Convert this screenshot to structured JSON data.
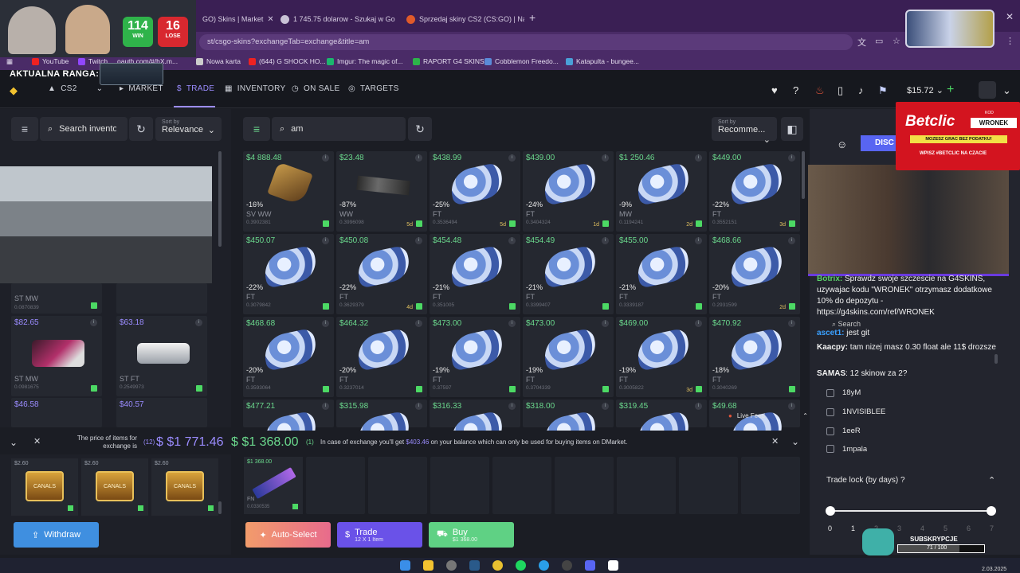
{
  "browser": {
    "tabs": [
      {
        "title": "GO) Skins | Market"
      },
      {
        "title": "1 745.75 dolarow - Szukaj w Go"
      },
      {
        "title": "Sprzedaj skiny CS2 (CS:GO) | Na"
      }
    ],
    "url": "st/csgo-skins?exchangeTab=exchange&title=am",
    "bookmarks": [
      "YouTube",
      "Twitch",
      "oauth.com/#/hX.m...",
      "Nowa karta",
      "(644) G SHOCK HO...",
      "Imgur: The magic of...",
      "RAPORT G4 SKINS",
      "Cobblemon Freedo...",
      "Katapulta - bungee..."
    ]
  },
  "overlay": {
    "win": {
      "count": "114",
      "label": "WIN"
    },
    "lose": {
      "count": "16",
      "label": "LOSE"
    },
    "rank_label": "AKTUALNA RANGA:",
    "betclic": {
      "logo": "Betclic",
      "kod": "KOD",
      "code": "WRONEK",
      "strip": "MOZESZ GRAC BEZ PODATKU!",
      "foot": "WPISZ #BETCLIC NA CZACIE"
    },
    "sub_goal": {
      "label": "SUBSKRYPCJE",
      "progress": "71 / 100"
    }
  },
  "site": {
    "game": "CS2",
    "nav": {
      "market": "MARKET",
      "trade": "TRADE",
      "inventory": "INVENTORY",
      "on_sale": "ON SALE",
      "targets": "TARGETS"
    },
    "balance": "$15.72"
  },
  "left_panel": {
    "search_placeholder": "Search inventory",
    "sort_label": "Sort by",
    "sort_value": "Relevance",
    "items": [
      {
        "ext": "ST MW",
        "float": "0.0870839"
      },
      {
        "price": "$82.65",
        "ext": "ST MW",
        "float": "0.0981675"
      },
      {
        "price": "$63.18",
        "ext": "ST FT",
        "float": "0.2549973"
      },
      {
        "price": "$46.58"
      },
      {
        "price": "$40.57"
      }
    ]
  },
  "market": {
    "search_value": "am",
    "sort_label": "Sort by",
    "sort_value": "Recomme...",
    "cards": [
      {
        "price": "$4 888.48",
        "disc": "-16%",
        "ext": "SV WW",
        "float": "0.3902381",
        "days": ""
      },
      {
        "price": "$23.48",
        "disc": "-87%",
        "ext": "WW",
        "float": "0.3996098",
        "days": "5d"
      },
      {
        "price": "$438.99",
        "disc": "-25%",
        "ext": "FT",
        "float": "0.3536494",
        "days": "5d"
      },
      {
        "price": "$439.00",
        "disc": "-24%",
        "ext": "FT",
        "float": "0.3404324",
        "days": "1d"
      },
      {
        "price": "$1 250.46",
        "disc": "-9%",
        "ext": "MW",
        "float": "0.1194241",
        "days": "2d"
      },
      {
        "price": "$449.00",
        "disc": "-22%",
        "ext": "FT",
        "float": "0.3552151",
        "days": "3d"
      },
      {
        "price": "$450.07",
        "disc": "-22%",
        "ext": "FT",
        "float": "0.3079842",
        "days": ""
      },
      {
        "price": "$450.08",
        "disc": "-22%",
        "ext": "FT",
        "float": "0.3629379",
        "days": "4d"
      },
      {
        "price": "$454.48",
        "disc": "-21%",
        "ext": "FT",
        "float": "0.351005",
        "days": ""
      },
      {
        "price": "$454.49",
        "disc": "-21%",
        "ext": "FT",
        "float": "0.3399407",
        "days": ""
      },
      {
        "price": "$455.00",
        "disc": "-21%",
        "ext": "FT",
        "float": "0.3339187",
        "days": ""
      },
      {
        "price": "$468.66",
        "disc": "-20%",
        "ext": "FT",
        "float": "0.2931599",
        "days": "2d"
      },
      {
        "price": "$468.68",
        "disc": "-20%",
        "ext": "FT",
        "float": "0.3593064",
        "days": ""
      },
      {
        "price": "$464.32",
        "disc": "-20%",
        "ext": "FT",
        "float": "0.3237014",
        "days": ""
      },
      {
        "price": "$473.00",
        "disc": "-19%",
        "ext": "FT",
        "float": "0.37597",
        "days": ""
      },
      {
        "price": "$473.00",
        "disc": "-19%",
        "ext": "FT",
        "float": "0.3704339",
        "days": ""
      },
      {
        "price": "$469.00",
        "disc": "-19%",
        "ext": "FT",
        "float": "0.3005822",
        "days": "3d"
      },
      {
        "price": "$470.92",
        "disc": "-18%",
        "ext": "FT",
        "float": "0.3040269",
        "days": ""
      },
      {
        "price": "$477.21"
      },
      {
        "price": "$315.98"
      },
      {
        "price": "$316.33"
      },
      {
        "price": "$318.00"
      },
      {
        "price": "$319.45"
      },
      {
        "price": "$49.68"
      }
    ],
    "live_feed": "Live Feed"
  },
  "tradebar": {
    "price_label": "The price of items for exchange is",
    "left_count": "(12)",
    "left_total": "$1 771.46",
    "right_total": "$1 368.00",
    "right_count": "(1)",
    "info_pre": "In case of exchange you'll get",
    "info_amount": "$403.46",
    "info_post": "on your balance which can only be used for buying items on DMarket."
  },
  "exchange": {
    "cases": [
      {
        "price": "$2.60",
        "name": "CANALS"
      },
      {
        "price": "$2.60",
        "name": "CANALS"
      },
      {
        "price": "$2.60",
        "name": "CANALS"
      }
    ],
    "selected": {
      "price": "$1 368.00",
      "ext": "FN",
      "float": "0.0330535"
    },
    "withdraw": "Withdraw",
    "auto_select": "Auto-Select",
    "trade": "Trade",
    "trade_sub": "12 X 1 Item",
    "buy": "Buy",
    "buy_sub": "$1 368.00"
  },
  "right_panel": {
    "discord": "DISC",
    "chat": [
      {
        "user": "Botrix:",
        "text": "Sprawdz swoje szczescie na G4SKINS, uzywajac kodu \"WRONEK\" otrzymasz dodatkowe 10% do depozytu - https://g4skins.com/ref/WRONEK"
      },
      {
        "user": "ascet1:",
        "text": "jest git"
      },
      {
        "user": "Kaacpy:",
        "text": "tam nizej masz 0.30 float ale 11$ drozsze"
      },
      {
        "user": "SAMAS",
        "text": ": 12 skinow za 2?"
      }
    ],
    "search_label": "Search",
    "filters": [
      "18yM",
      "1NVISIBLEE",
      "1eeR",
      "1mpala"
    ],
    "trade_lock": "Trade lock (by days)",
    "ticks": [
      "0",
      "1",
      "2",
      "3",
      "4",
      "5",
      "6",
      "7"
    ]
  },
  "taskbar": {
    "time": "2.03.2025"
  }
}
